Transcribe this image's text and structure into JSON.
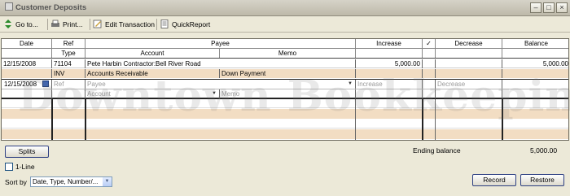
{
  "window": {
    "title": "Customer Deposits"
  },
  "toolbar": {
    "goto": "Go to...",
    "print": "Print...",
    "edit": "Edit Transaction",
    "quickreport": "QuickReport"
  },
  "columns": {
    "date": "Date",
    "ref": "Ref",
    "type": "Type",
    "payee": "Payee",
    "account": "Account",
    "memo": "Memo",
    "increase": "Increase",
    "check": "✓",
    "decrease": "Decrease",
    "balance": "Balance"
  },
  "transaction": {
    "date": "12/15/2008",
    "ref": "71104",
    "type": "INV",
    "payee": "Pete Harbin Contractor:Bell River Road",
    "account": "Accounts Receivable",
    "memo": "Down Payment",
    "increase": "5,000.00",
    "decrease": "",
    "balance": "5,000.00"
  },
  "new_entry": {
    "date": "12/15/2008",
    "ref_placeholder": "Ref",
    "payee_placeholder": "Payee",
    "account_placeholder": "Account",
    "memo_placeholder": "Memo",
    "increase_placeholder": "Increase",
    "decrease_placeholder": "Decrease"
  },
  "footer": {
    "splits": "Splits",
    "ending_balance_label": "Ending balance",
    "ending_balance": "5,000.00",
    "one_line": "1-Line",
    "sort_by_label": "Sort by",
    "sort_by_value": "Date, Type, Number/...",
    "record": "Record",
    "restore": "Restore"
  },
  "watermark": "Downtown Bookkeeping",
  "colors": {
    "alt_row": "#f2ddc3",
    "background": "#ece9d8"
  }
}
